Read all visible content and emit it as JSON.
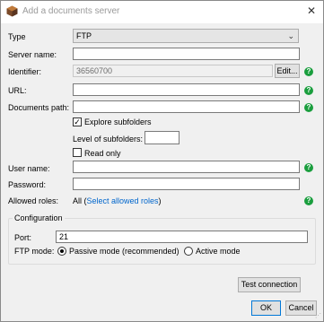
{
  "window": {
    "title": "Add a documents server",
    "close_glyph": "✕"
  },
  "form": {
    "type": {
      "label": "Type",
      "value": "FTP"
    },
    "server_name": {
      "label": "Server name:",
      "value": ""
    },
    "identifier": {
      "label": "Identifier:",
      "value": "36560700",
      "edit_label": "Edit..."
    },
    "url": {
      "label": "URL:",
      "value": ""
    },
    "documents_path": {
      "label": "Documents path:",
      "value": ""
    },
    "explore_subfolders": {
      "label": "Explore subfolders",
      "checked": true
    },
    "level_of_subfolders": {
      "label": "Level of subfolders:",
      "value": ""
    },
    "read_only": {
      "label": "Read only",
      "checked": false
    },
    "user_name": {
      "label": "User name:",
      "value": ""
    },
    "password": {
      "label": "Password:",
      "value": ""
    },
    "allowed_roles": {
      "label": "Allowed roles:",
      "prefix": "All (",
      "link": "Select allowed roles",
      "suffix": ")"
    }
  },
  "configuration": {
    "title": "Configuration",
    "port": {
      "label": "Port:",
      "value": "21"
    },
    "ftp_mode": {
      "label": "FTP mode:",
      "options": [
        "Passive mode (recommended)",
        "Active mode"
      ],
      "selected": "Passive mode (recommended)"
    }
  },
  "buttons": {
    "test_connection": "Test connection",
    "ok": "OK",
    "cancel": "Cancel"
  },
  "help_glyph": "?",
  "check_glyph": "✓",
  "chevron_glyph": "⌄",
  "colors": {
    "help": "#1a9e3e",
    "link": "#0066cc",
    "accent": "#0078d7"
  }
}
